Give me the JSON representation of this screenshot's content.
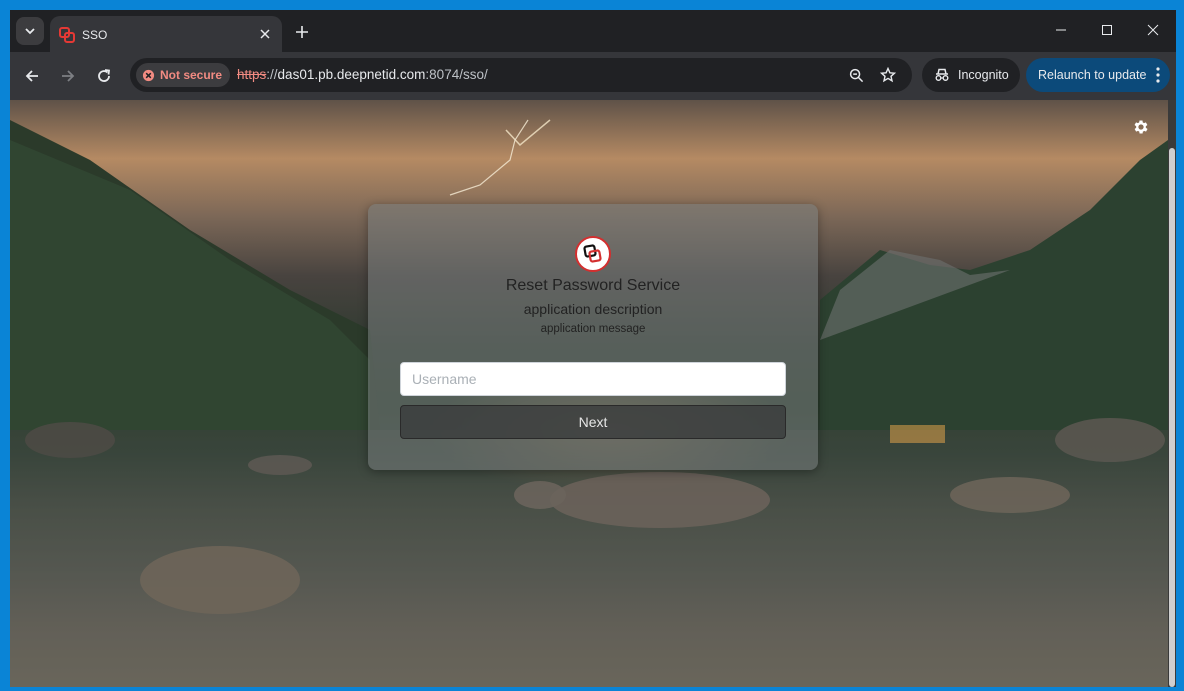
{
  "browser": {
    "tab": {
      "title": "SSO",
      "favicon": "sso-logo-icon"
    },
    "new_tab_icon": "plus-icon",
    "window_controls": [
      "minimize-icon",
      "maximize-icon",
      "close-icon"
    ],
    "security": {
      "label": "Not secure",
      "color": "#f28b82"
    },
    "url": {
      "scheme": "https",
      "separator": "://",
      "host": "das01.pb.deepnetid.com",
      "rest": ":8074/sso/"
    },
    "incognito_label": "Incognito",
    "relaunch_label": "Relaunch to update",
    "accent_color": "#0c4a7a"
  },
  "page": {
    "settings_icon": "gear-icon",
    "card": {
      "logo": "sso-logo-icon",
      "title": "Reset Password Service",
      "description": "application description",
      "message": "application message",
      "username_placeholder": "Username",
      "next_label": "Next"
    }
  }
}
